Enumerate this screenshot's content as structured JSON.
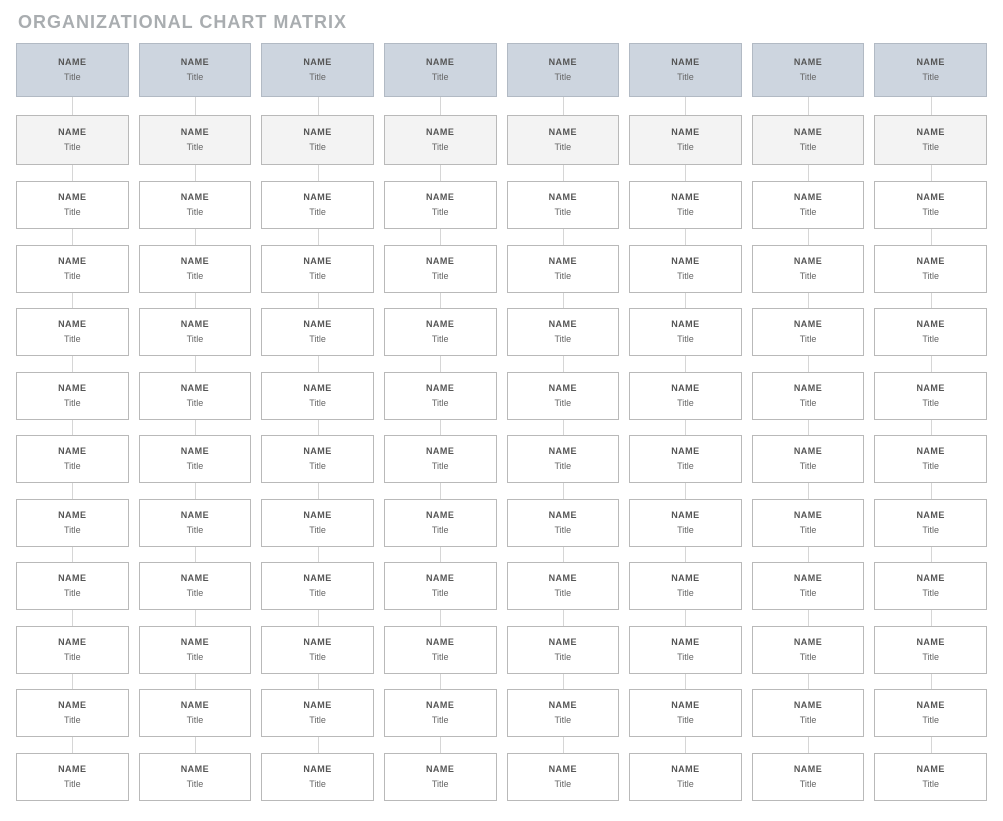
{
  "page_title": "ORGANIZATIONAL CHART MATRIX",
  "columns": 8,
  "rows": 12,
  "defaults": {
    "name": "NAME",
    "title": "Title"
  },
  "grid": [
    [
      {
        "name": "NAME",
        "title": "Title"
      },
      {
        "name": "NAME",
        "title": "Title"
      },
      {
        "name": "NAME",
        "title": "Title"
      },
      {
        "name": "NAME",
        "title": "Title"
      },
      {
        "name": "NAME",
        "title": "Title"
      },
      {
        "name": "NAME",
        "title": "Title"
      },
      {
        "name": "NAME",
        "title": "Title"
      },
      {
        "name": "NAME",
        "title": "Title"
      }
    ],
    [
      {
        "name": "NAME",
        "title": "Title"
      },
      {
        "name": "NAME",
        "title": "Title"
      },
      {
        "name": "NAME",
        "title": "Title"
      },
      {
        "name": "NAME",
        "title": "Title"
      },
      {
        "name": "NAME",
        "title": "Title"
      },
      {
        "name": "NAME",
        "title": "Title"
      },
      {
        "name": "NAME",
        "title": "Title"
      },
      {
        "name": "NAME",
        "title": "Title"
      }
    ],
    [
      {
        "name": "NAME",
        "title": "Title"
      },
      {
        "name": "NAME",
        "title": "Title"
      },
      {
        "name": "NAME",
        "title": "Title"
      },
      {
        "name": "NAME",
        "title": "Title"
      },
      {
        "name": "NAME",
        "title": "Title"
      },
      {
        "name": "NAME",
        "title": "Title"
      },
      {
        "name": "NAME",
        "title": "Title"
      },
      {
        "name": "NAME",
        "title": "Title"
      }
    ],
    [
      {
        "name": "NAME",
        "title": "Title"
      },
      {
        "name": "NAME",
        "title": "Title"
      },
      {
        "name": "NAME",
        "title": "Title"
      },
      {
        "name": "NAME",
        "title": "Title"
      },
      {
        "name": "NAME",
        "title": "Title"
      },
      {
        "name": "NAME",
        "title": "Title"
      },
      {
        "name": "NAME",
        "title": "Title"
      },
      {
        "name": "NAME",
        "title": "Title"
      }
    ],
    [
      {
        "name": "NAME",
        "title": "Title"
      },
      {
        "name": "NAME",
        "title": "Title"
      },
      {
        "name": "NAME",
        "title": "Title"
      },
      {
        "name": "NAME",
        "title": "Title"
      },
      {
        "name": "NAME",
        "title": "Title"
      },
      {
        "name": "NAME",
        "title": "Title"
      },
      {
        "name": "NAME",
        "title": "Title"
      },
      {
        "name": "NAME",
        "title": "Title"
      }
    ],
    [
      {
        "name": "NAME",
        "title": "Title"
      },
      {
        "name": "NAME",
        "title": "Title"
      },
      {
        "name": "NAME",
        "title": "Title"
      },
      {
        "name": "NAME",
        "title": "Title"
      },
      {
        "name": "NAME",
        "title": "Title"
      },
      {
        "name": "NAME",
        "title": "Title"
      },
      {
        "name": "NAME",
        "title": "Title"
      },
      {
        "name": "NAME",
        "title": "Title"
      }
    ],
    [
      {
        "name": "NAME",
        "title": "Title"
      },
      {
        "name": "NAME",
        "title": "Title"
      },
      {
        "name": "NAME",
        "title": "Title"
      },
      {
        "name": "NAME",
        "title": "Title"
      },
      {
        "name": "NAME",
        "title": "Title"
      },
      {
        "name": "NAME",
        "title": "Title"
      },
      {
        "name": "NAME",
        "title": "Title"
      },
      {
        "name": "NAME",
        "title": "Title"
      }
    ],
    [
      {
        "name": "NAME",
        "title": "Title"
      },
      {
        "name": "NAME",
        "title": "Title"
      },
      {
        "name": "NAME",
        "title": "Title"
      },
      {
        "name": "NAME",
        "title": "Title"
      },
      {
        "name": "NAME",
        "title": "Title"
      },
      {
        "name": "NAME",
        "title": "Title"
      },
      {
        "name": "NAME",
        "title": "Title"
      },
      {
        "name": "NAME",
        "title": "Title"
      }
    ],
    [
      {
        "name": "NAME",
        "title": "Title"
      },
      {
        "name": "NAME",
        "title": "Title"
      },
      {
        "name": "NAME",
        "title": "Title"
      },
      {
        "name": "NAME",
        "title": "Title"
      },
      {
        "name": "NAME",
        "title": "Title"
      },
      {
        "name": "NAME",
        "title": "Title"
      },
      {
        "name": "NAME",
        "title": "Title"
      },
      {
        "name": "NAME",
        "title": "Title"
      }
    ],
    [
      {
        "name": "NAME",
        "title": "Title"
      },
      {
        "name": "NAME",
        "title": "Title"
      },
      {
        "name": "NAME",
        "title": "Title"
      },
      {
        "name": "NAME",
        "title": "Title"
      },
      {
        "name": "NAME",
        "title": "Title"
      },
      {
        "name": "NAME",
        "title": "Title"
      },
      {
        "name": "NAME",
        "title": "Title"
      },
      {
        "name": "NAME",
        "title": "Title"
      }
    ],
    [
      {
        "name": "NAME",
        "title": "Title"
      },
      {
        "name": "NAME",
        "title": "Title"
      },
      {
        "name": "NAME",
        "title": "Title"
      },
      {
        "name": "NAME",
        "title": "Title"
      },
      {
        "name": "NAME",
        "title": "Title"
      },
      {
        "name": "NAME",
        "title": "Title"
      },
      {
        "name": "NAME",
        "title": "Title"
      },
      {
        "name": "NAME",
        "title": "Title"
      }
    ],
    [
      {
        "name": "NAME",
        "title": "Title"
      },
      {
        "name": "NAME",
        "title": "Title"
      },
      {
        "name": "NAME",
        "title": "Title"
      },
      {
        "name": "NAME",
        "title": "Title"
      },
      {
        "name": "NAME",
        "title": "Title"
      },
      {
        "name": "NAME",
        "title": "Title"
      },
      {
        "name": "NAME",
        "title": "Title"
      },
      {
        "name": "NAME",
        "title": "Title"
      }
    ]
  ]
}
